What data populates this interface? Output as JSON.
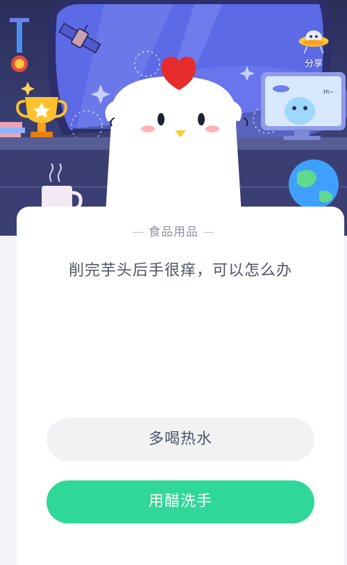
{
  "header": {
    "share_label": "分享"
  },
  "quiz": {
    "category": "食品用品",
    "question": "削完芋头后手很痒，可以怎么办",
    "options": [
      {
        "label": "多喝热水"
      },
      {
        "label": "用醋洗手"
      }
    ]
  },
  "colors": {
    "scene_background": "#34396b",
    "card_background": "#ffffff",
    "option_default": "#f1f2f4",
    "option_highlight": "#2fd898"
  },
  "icons": [
    "satellite-icon",
    "trophy-icon",
    "medal-icon",
    "ufo-share-icon",
    "monitor-alien-icon",
    "globe-icon",
    "mug-icon",
    "chick-mascot"
  ]
}
